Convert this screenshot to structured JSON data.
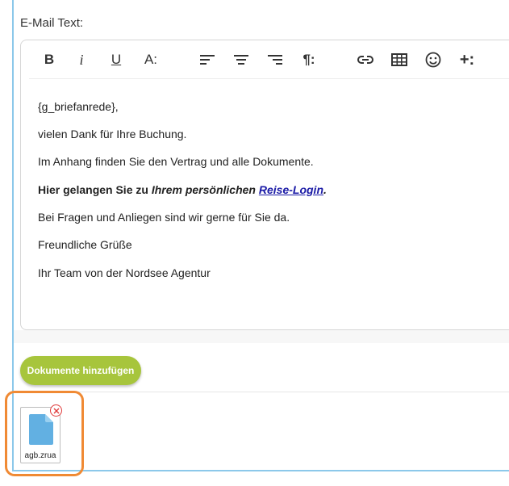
{
  "field": {
    "label": "E-Mail Text:"
  },
  "toolbar": {
    "bold": "B",
    "italic": "i",
    "underline": "U",
    "font_size": "A:",
    "paragraph": "¶:",
    "more": "+:"
  },
  "content": {
    "greeting": "{g_briefanrede},",
    "line1": "vielen Dank für Ihre Buchung.",
    "line2": "Im Anhang finden Sie den Vertrag und alle Dokumente.",
    "line3_prefix": "Hier gelangen Sie zu ",
    "line3_italic": "Ihrem persönlichen ",
    "line3_link": "Reise-Login",
    "line3_suffix": ".",
    "line4": "Bei Fragen und Anliegen sind wir gerne für Sie da.",
    "line5": "Freundliche Grüße",
    "line6": "Ihr Team von der Nordsee Agentur"
  },
  "actions": {
    "add_document": "Dokumente hinzufügen"
  },
  "attachments": [
    {
      "file_name": "agb.zrua"
    }
  ],
  "colors": {
    "accent_green": "#a7c53c",
    "highlight_orange": "#f08a34",
    "file_blue": "#62b0e2",
    "remove_red": "#e03a3a"
  }
}
